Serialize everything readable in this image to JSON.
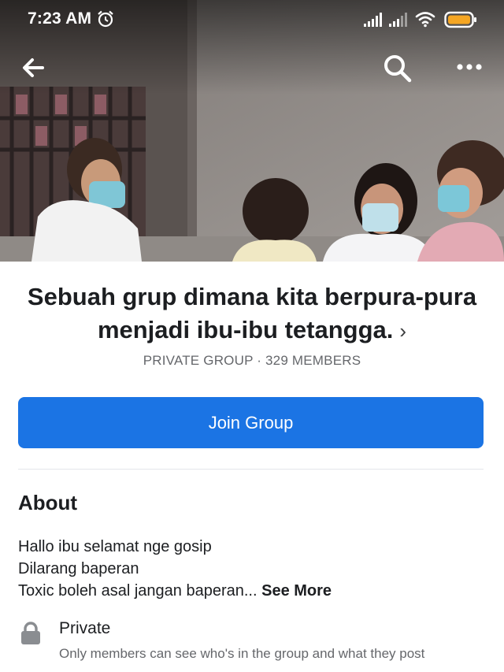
{
  "status_bar": {
    "time": "7:23 AM",
    "icons": [
      "alarm-icon",
      "signal-icon",
      "signal-icon",
      "wifi-icon",
      "battery-icon"
    ],
    "battery_color": "#f5a623"
  },
  "nav": {
    "icons": [
      "back-arrow-icon",
      "search-icon",
      "more-icon"
    ]
  },
  "group": {
    "title": "Sebuah grup dimana kita berpura-pura menjadi ibu-ibu tetangga.",
    "chevron": "›",
    "meta": "PRIVATE GROUP · 329 MEMBERS",
    "join_label": "Join Group"
  },
  "about": {
    "heading": "About",
    "lines": [
      "Hallo ibu selamat nge gosip",
      "Dilarang baperan",
      "Toxic boleh asal jangan baperan..."
    ],
    "see_more": "See More"
  },
  "privacy": {
    "title": "Private",
    "description": "Only members can see who's in the group and what they post"
  },
  "colors": {
    "accent": "#1b74e4",
    "text_primary": "#1c1e21",
    "text_secondary": "#65676b"
  }
}
